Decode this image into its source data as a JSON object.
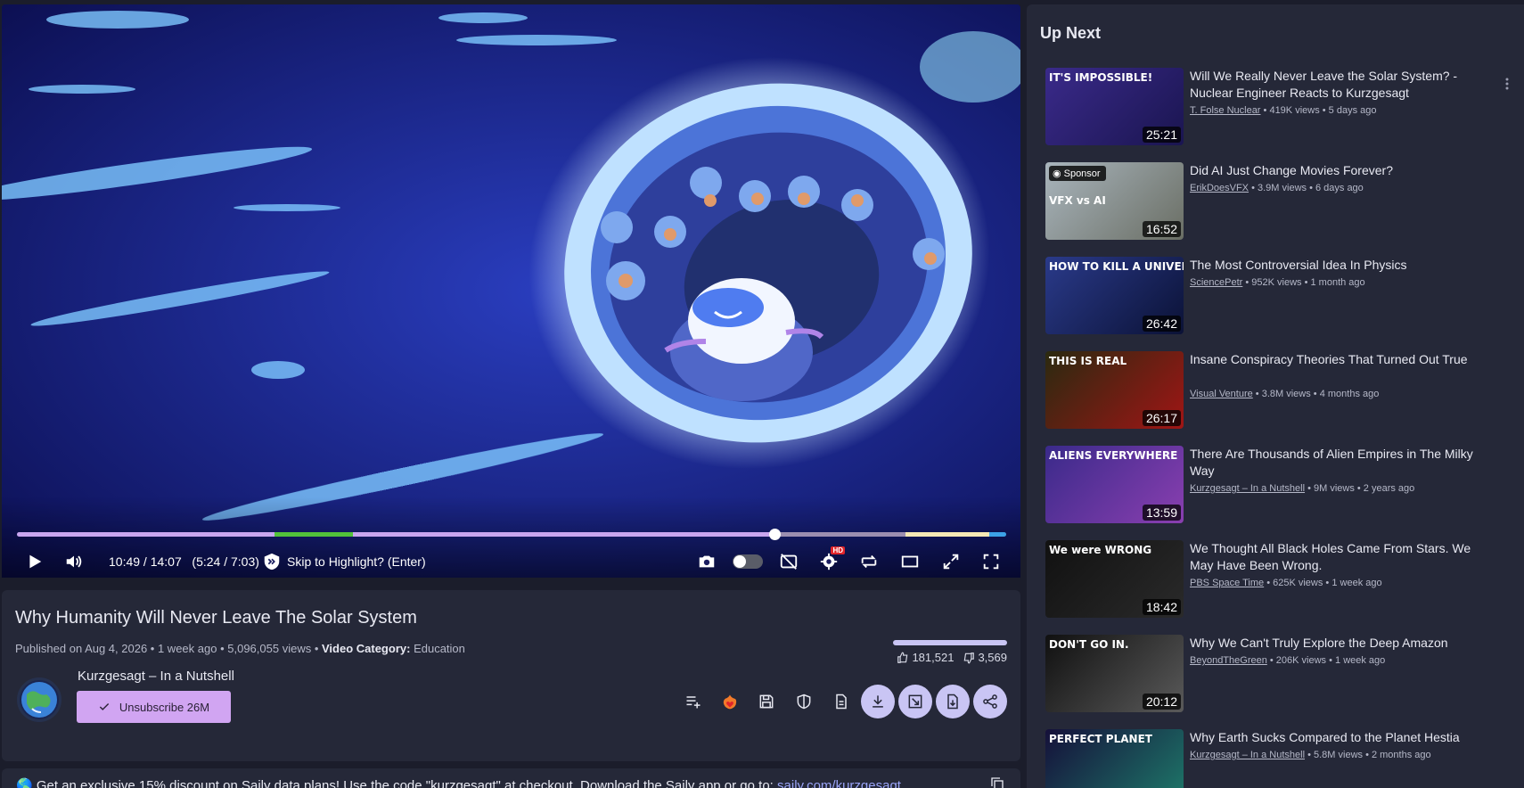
{
  "player": {
    "time_display": "10:49 / 14:07",
    "chapter_time": "(5:24 / 7:03)",
    "skip_label": "Skip to Highlight? (Enter)",
    "progress_fraction": 0.766,
    "hd_badge": "HD"
  },
  "video": {
    "title": "Why Humanity Will Never Leave The Solar System",
    "published": "Published on Aug 4, 2026",
    "age": "1 week ago",
    "views": "5,096,055 views",
    "category_label": "Video Category:",
    "category": "Education",
    "likes": "181,521",
    "dislikes": "3,569",
    "like_ratio": 0.98
  },
  "channel": {
    "name": "Kurzgesagt – In a Nutshell",
    "unsubscribe_label": "Unsubscribe 26M"
  },
  "description": {
    "text": "Get an exclusive 15% discount on Saily data plans! Use the code \"kurzgesagt\" at checkout. Download the Saily app or go to:",
    "link": "saily.com/kurzgesagt"
  },
  "sidebar": {
    "heading": "Up Next",
    "items": [
      {
        "title": "Will We Really Never Leave the Solar System? - Nuclear Engineer Reacts to Kurzgesagt",
        "channel": "T. Folse Nuclear",
        "stats": " • 419K views • 5 days ago",
        "duration": "25:21",
        "thumb_text": "IT'S IMPOSSIBLE!",
        "colors": [
          "#3a2a8a",
          "#1a1550"
        ]
      },
      {
        "title": "Did AI Just Change Movies Forever?",
        "channel": "ErikDoesVFX",
        "stats": " • 3.9M views • 6 days ago",
        "duration": "16:52",
        "thumb_text": "VFX vs AI",
        "sponsor": "Sponsor",
        "colors": [
          "#a9b5bd",
          "#6a6e64"
        ]
      },
      {
        "title": "The Most Controversial Idea In Physics",
        "channel": "SciencePetr",
        "stats": " • 952K views • 1 month ago",
        "duration": "26:42",
        "thumb_text": "HOW TO KILL A UNIVERSE",
        "colors": [
          "#2a3a8a",
          "#0b1236"
        ]
      },
      {
        "title": "Insane Conspiracy Theories That Turned Out True",
        "channel": "Visual Venture",
        "stats": " • 3.8M views • 4 months ago",
        "duration": "26:17",
        "thumb_text": "THIS IS REAL",
        "colors": [
          "#2a2a10",
          "#a01515"
        ]
      },
      {
        "title": "There Are Thousands of Alien Empires in The Milky Way",
        "channel": "Kurzgesagt – In a Nutshell",
        "stats": " • 9M views • 2 years ago",
        "duration": "13:59",
        "thumb_text": "ALIENS EVERYWHERE",
        "colors": [
          "#3a2a8a",
          "#8a3fb0"
        ]
      },
      {
        "title": "We Thought All Black Holes Came From Stars. We May Have Been Wrong.",
        "channel": "PBS Space Time",
        "stats": " • 625K views • 1 week ago",
        "duration": "18:42",
        "thumb_text": "We were WRONG",
        "colors": [
          "#111111",
          "#2a2a2a"
        ]
      },
      {
        "title": "Why We Can't Truly Explore the Deep Amazon",
        "channel": "BeyondTheGreen",
        "stats": " • 206K views • 1 week ago",
        "duration": "20:12",
        "thumb_text": "DON'T GO IN.",
        "colors": [
          "#101010",
          "#5a5a5a"
        ]
      },
      {
        "title": "Why Earth Sucks Compared to the Planet Hestia",
        "channel": "Kurzgesagt – In a Nutshell",
        "stats": " • 5.8M views • 2 months ago",
        "duration": "",
        "thumb_text": "PERFECT PLANET",
        "colors": [
          "#15103a",
          "#1e7a6a"
        ]
      }
    ]
  }
}
